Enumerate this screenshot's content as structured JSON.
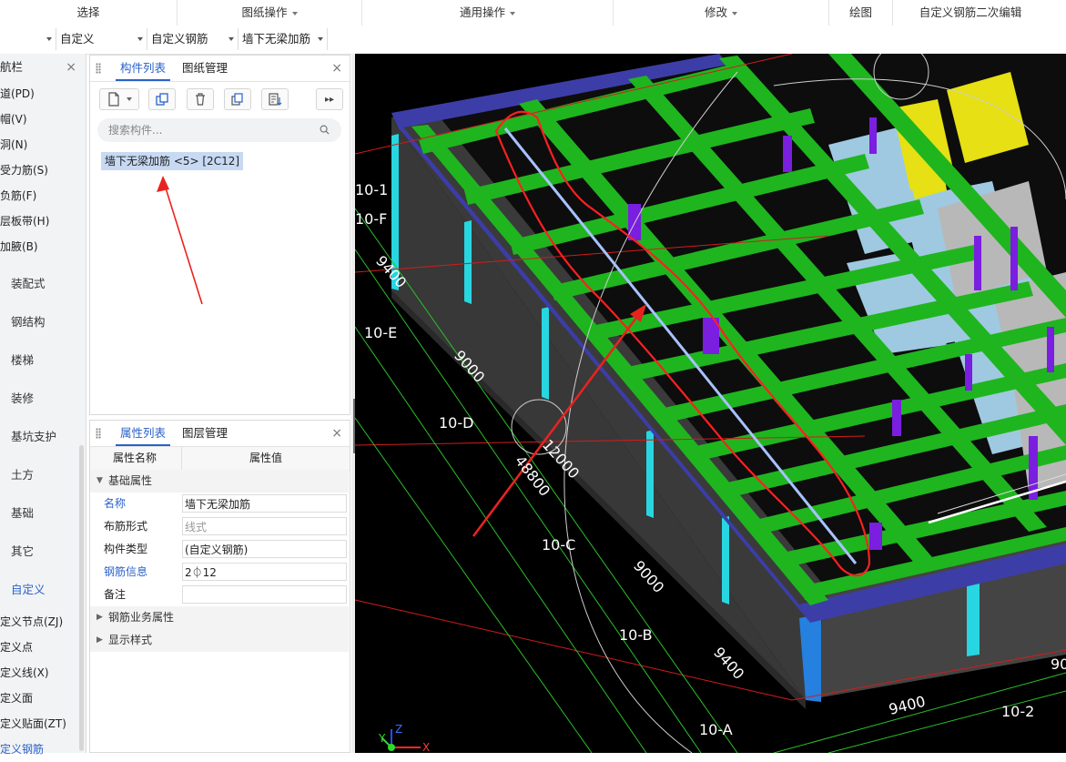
{
  "ribbon": {
    "groups": [
      {
        "label": "选择"
      },
      {
        "label": "图纸操作",
        "dropdown": true
      },
      {
        "label": "通用操作",
        "dropdown": true
      },
      {
        "label": "修改",
        "dropdown": true
      },
      {
        "label": "绘图"
      },
      {
        "label": "自定义钢筋二次编辑"
      }
    ]
  },
  "toolbar": {
    "combo_1": "",
    "combo_2": "自定义",
    "combo_3": "自定义钢筋",
    "combo_4": "墙下无梁加筋"
  },
  "nav": {
    "title": "航栏",
    "close": "×",
    "top_items": [
      "道(PD)",
      "帽(V)",
      "洞(N)",
      "受力筋(S)",
      "负筋(F)",
      "层板带(H)",
      "加腋(B)"
    ],
    "categories": [
      "装配式",
      "钢结构",
      "楼梯",
      "装修",
      "基坑支护",
      "土方",
      "基础",
      "其它",
      "自定义"
    ],
    "active_category": "自定义",
    "sub_items": [
      "定义节点(ZJ)",
      "定义点",
      "定义线(X)",
      "定义面",
      "定义贴面(ZT)",
      "定义钢筋"
    ],
    "active_sub": "定义钢筋"
  },
  "component_panel": {
    "tab_active": "构件列表",
    "tab_other": "图纸管理",
    "close": "×",
    "search_placeholder": "搜索构件...",
    "item": "墙下无梁加筋 <5> [2C12]",
    "more": "▸▸"
  },
  "property_panel": {
    "tab_active": "属性列表",
    "tab_other": "图层管理",
    "close": "×",
    "col_name": "属性名称",
    "col_value": "属性值",
    "section_basic": "基础属性",
    "rows": [
      {
        "key": "名称",
        "value": "墙下无梁加筋",
        "blue": true
      },
      {
        "key": "布筋形式",
        "value": "线式",
        "grey": true
      },
      {
        "key": "构件类型",
        "value": "(自定义钢筋)"
      },
      {
        "key": "钢筋信息",
        "value": "2⏀12",
        "blue": true
      },
      {
        "key": "备注",
        "value": ""
      }
    ],
    "section_rebar": "钢筋业务属性",
    "section_display": "显示样式"
  },
  "viewport": {
    "axis_labels": [
      "10-1",
      "10-F",
      "10-E",
      "10-D",
      "10-C",
      "10-B",
      "10-A",
      "10-2"
    ],
    "dim_labels": [
      "9400",
      "9000",
      "12000",
      "48800",
      "9000",
      "9400",
      "9400",
      "90"
    ],
    "triad": {
      "x": "X",
      "y": "Y",
      "z": "Z"
    },
    "colors": {
      "beam": "#1fb51f",
      "wall": "#3a3a3a",
      "top_edge": "#3d3da8",
      "column": "#7a1ee0",
      "highlight": "#ff2020"
    }
  }
}
